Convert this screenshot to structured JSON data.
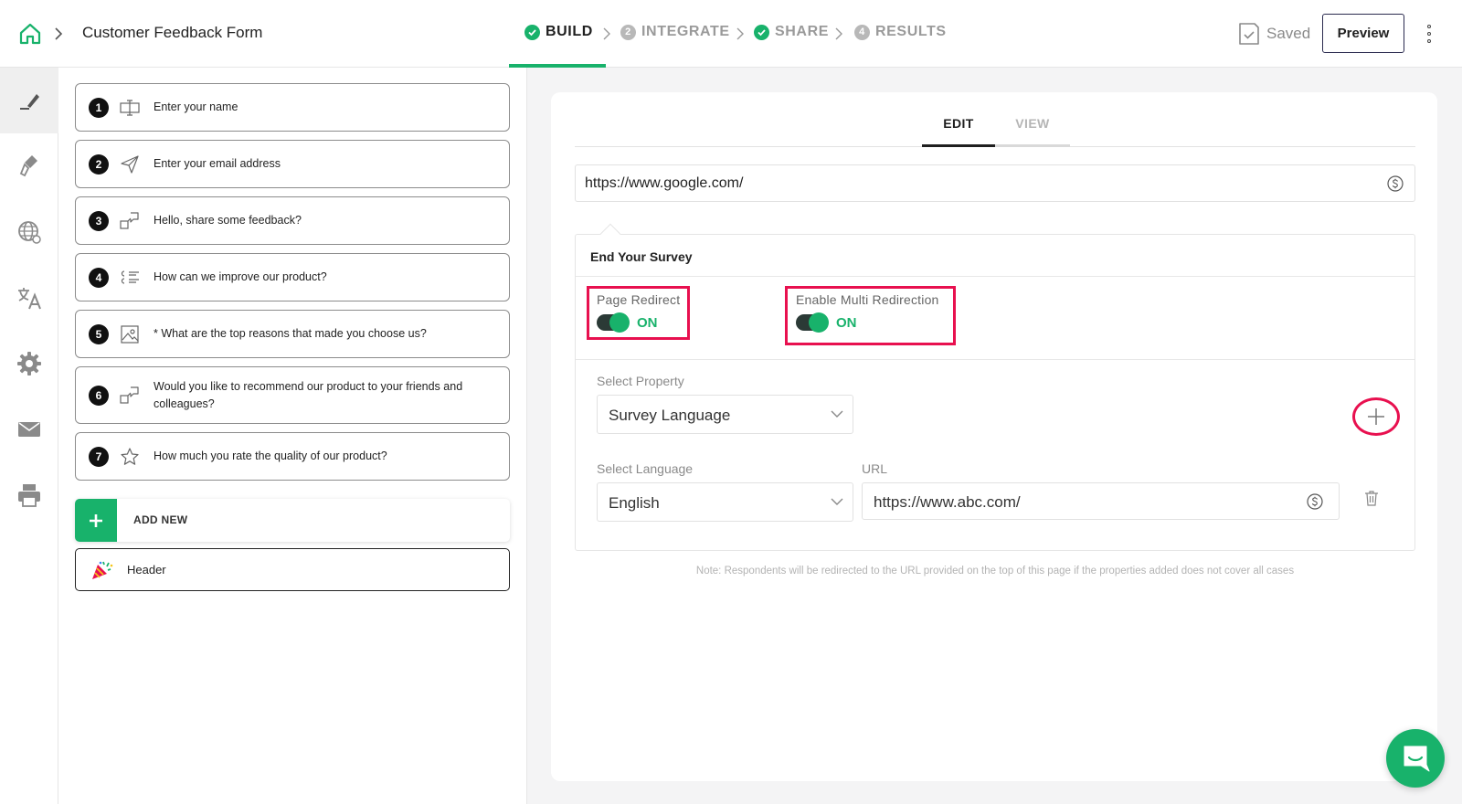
{
  "header": {
    "form_title": "Customer Feedback Form",
    "steps": [
      {
        "label": "BUILD",
        "badge": "",
        "state": "done"
      },
      {
        "label": "INTEGRATE",
        "badge": "2",
        "state": "pending"
      },
      {
        "label": "SHARE",
        "badge": "",
        "state": "done"
      },
      {
        "label": "RESULTS",
        "badge": "4",
        "state": "pending"
      }
    ],
    "saved_label": "Saved",
    "preview_label": "Preview"
  },
  "rail": {
    "icons": [
      "edit-icon",
      "brush-icon",
      "globe-icon",
      "translate-icon",
      "settings-icon",
      "mail-icon",
      "print-icon"
    ]
  },
  "questions": [
    {
      "number": "1",
      "icon": "text-input-icon",
      "text": "Enter your name"
    },
    {
      "number": "2",
      "icon": "send-icon",
      "text": "Enter your email address"
    },
    {
      "number": "3",
      "icon": "feedback-icon",
      "text": "Hello, share some feedback?"
    },
    {
      "number": "4",
      "icon": "list-icon",
      "text": "How can we improve our product?"
    },
    {
      "number": "5",
      "icon": "image-icon",
      "text": "* What are the top reasons that made you choose us?"
    },
    {
      "number": "6",
      "icon": "feedback-icon",
      "text": "Would you like to recommend our product to your friends and colleagues?"
    },
    {
      "number": "7",
      "icon": "star-icon",
      "text": "How much you rate the quality of our product?"
    }
  ],
  "add_new_label": "ADD NEW",
  "header_item_label": "Header",
  "editor": {
    "tabs": {
      "edit": "EDIT",
      "view": "VIEW"
    },
    "redirect_url": "https://www.google.com/",
    "end_survey": {
      "title": "End Your Survey",
      "page_redirect": {
        "label": "Page Redirect",
        "state": "ON"
      },
      "multi_redirection": {
        "label": "Enable Multi Redirection",
        "state": "ON"
      },
      "select_property_label": "Select Property",
      "select_property_value": "Survey Language",
      "select_language_label": "Select Language",
      "select_language_value": "English",
      "url_label": "URL",
      "url_value": "https://www.abc.com/"
    },
    "note": "Note: Respondents will be redirected to the URL provided on the top of this page if the properties added does not cover all cases"
  },
  "colors": {
    "accent": "#18b26b",
    "highlight": "#e8104f"
  }
}
